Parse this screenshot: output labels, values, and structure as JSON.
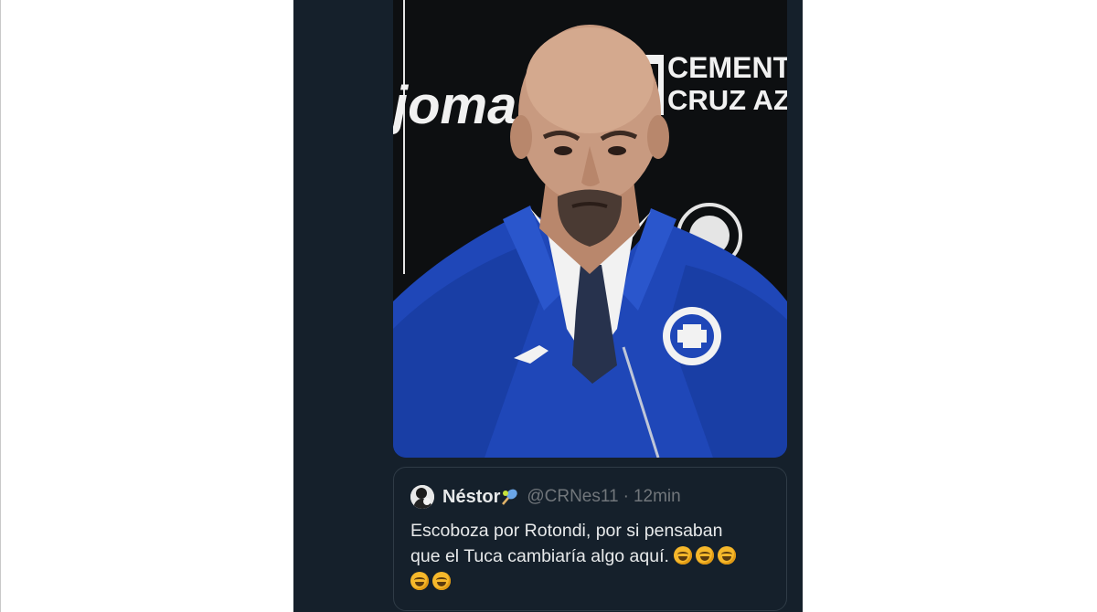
{
  "quoted_tweet": {
    "display_name": "Néstor",
    "handle": "@CRNes11",
    "separator": "·",
    "time": "12min",
    "text_line1": "Escoboza por Rotondi, por si pensaban",
    "text_line2": "que el Tuca cambiaría algo aquí.",
    "emoji_icon": "rolling-on-floor-laughing-icon",
    "emoji_count": 5
  },
  "media": {
    "backdrop_left_text": "joma",
    "backdrop_right_text_1": "CEMENTO",
    "backdrop_right_text_2": "CRUZ AZUL"
  },
  "colors": {
    "card_bg": "#15202b",
    "text_primary": "#e7e9ea",
    "text_secondary": "#71767b",
    "border": "#2f3b46",
    "jacket_blue": "#1f47b8"
  }
}
